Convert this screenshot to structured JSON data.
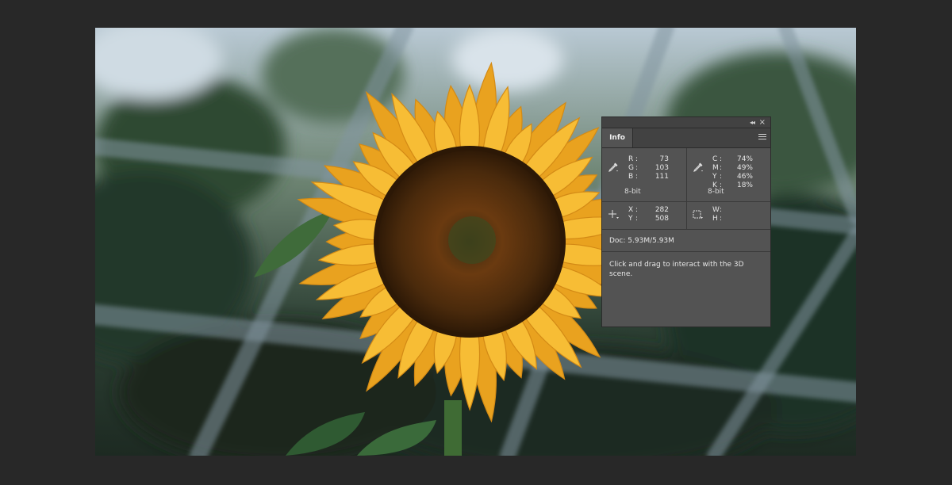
{
  "panel": {
    "tab_label": "Info",
    "collapse_glyph": "◂◂",
    "close_glyph": "×"
  },
  "rgb": {
    "labels": [
      "R",
      "G",
      "B"
    ],
    "values": [
      "73",
      "103",
      "111"
    ],
    "bit_depth": "8-bit"
  },
  "cmyk": {
    "labels": [
      "C",
      "M",
      "Y",
      "K"
    ],
    "values": [
      "74%",
      "49%",
      "46%",
      "18%"
    ],
    "bit_depth": "8-bit"
  },
  "position": {
    "labels": [
      "X",
      "Y"
    ],
    "values": [
      "282",
      "508"
    ]
  },
  "size": {
    "labels": [
      "W",
      "H"
    ],
    "values": [
      "",
      ""
    ]
  },
  "doc": "Doc: 5.93M/5.93M",
  "hint": "Click and drag to interact with the 3D scene.",
  "colors": {
    "app_background": "#282828",
    "panel_background": "#535353",
    "panel_header": "#424242",
    "sunflower_petal": "#f4b32a",
    "sunflower_center": "#4a2a0c"
  },
  "icons": {
    "collapse": "double-chevron-left-icon",
    "close": "close-icon",
    "menu": "panel-menu-icon",
    "eyedropper": "eyedropper-icon",
    "crosshair": "crosshair-icon",
    "selection": "marquee-selection-icon"
  }
}
